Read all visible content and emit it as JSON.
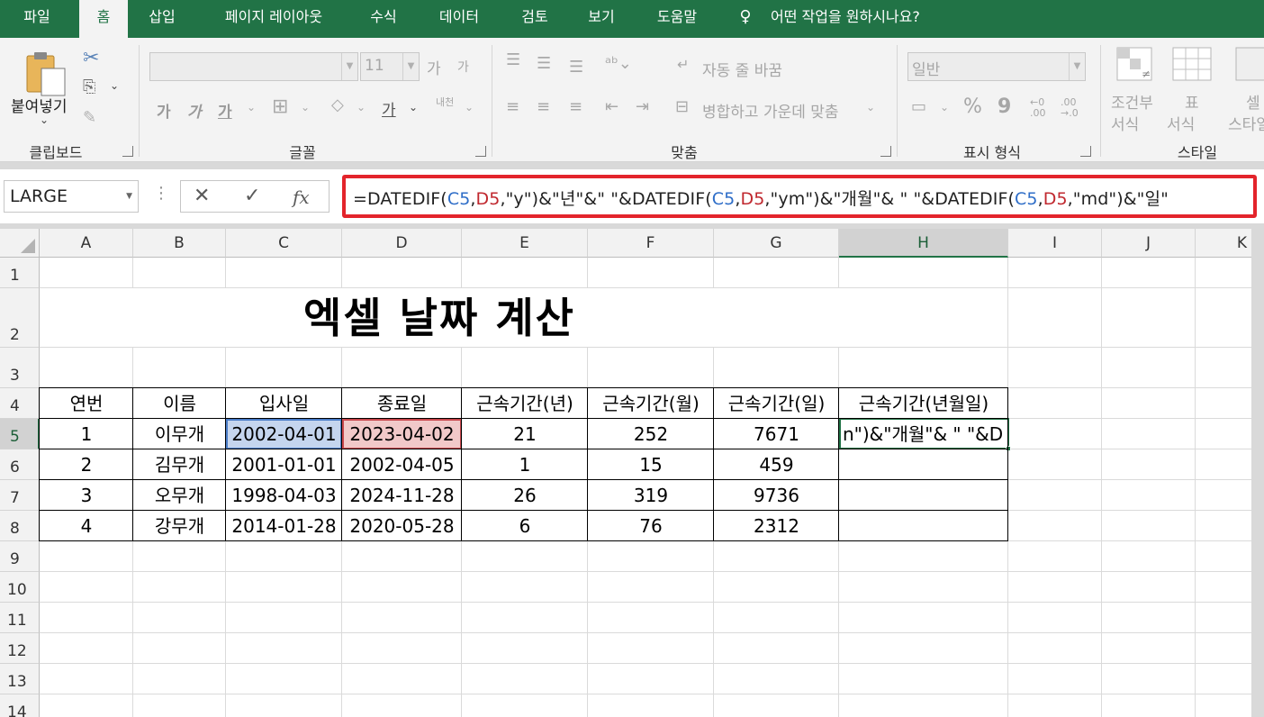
{
  "menu": {
    "tabs": [
      "파일",
      "홈",
      "삽입",
      "페이지 레이아웃",
      "수식",
      "데이터",
      "검토",
      "보기",
      "도움말"
    ],
    "active": "홈",
    "tell_me": "어떤 작업을 원하시나요?"
  },
  "ribbon": {
    "clipboard": {
      "paste": "붙여넣기",
      "label": "클립보드"
    },
    "font": {
      "size": "11",
      "grow": "가",
      "shrink": "가",
      "bold": "가",
      "italic": "가",
      "underline": "가",
      "font_color": "가",
      "phonetic": "내천",
      "label": "글꼴"
    },
    "align": {
      "wrap": "자동 줄 바꿈",
      "merge": "병합하고 가운데 맞춤",
      "label": "맞춤"
    },
    "number": {
      "format": "일반",
      "percent": "%",
      "comma": "9",
      "inc": "←0\n.00",
      "dec": ".00\n→.0",
      "label": "표시 형식"
    },
    "styles": {
      "cond1": "조건부",
      "cond2": "서식",
      "table1": "표",
      "table2": "서식",
      "cell1": "셀",
      "cell2": "스타일",
      "label": "스타일"
    }
  },
  "formula_bar": {
    "name_box": "LARGE",
    "fx": "fx",
    "formula_parts": [
      {
        "t": "=DATEDIF(",
        "k": ""
      },
      {
        "t": "C5",
        "k": "c"
      },
      {
        "t": ",",
        "k": ""
      },
      {
        "t": "D5",
        "k": "d"
      },
      {
        "t": ",\"y\")&\"년\"&\" \"&DATEDIF(",
        "k": ""
      },
      {
        "t": "C5",
        "k": "c"
      },
      {
        "t": ",",
        "k": ""
      },
      {
        "t": "D5",
        "k": "d"
      },
      {
        "t": ",\"ym\")&\"개월\"& \" \"&DATEDIF(",
        "k": ""
      },
      {
        "t": "C5",
        "k": "c"
      },
      {
        "t": ",",
        "k": ""
      },
      {
        "t": "D5",
        "k": "d"
      },
      {
        "t": ",\"md\")&\"일\"",
        "k": ""
      }
    ]
  },
  "sheet": {
    "columns": [
      "A",
      "B",
      "C",
      "D",
      "E",
      "F",
      "G",
      "H",
      "I",
      "J",
      "K"
    ],
    "selected_column": "H",
    "rows": [
      "1",
      "2",
      "3",
      "4",
      "5",
      "6",
      "7",
      "8",
      "9",
      "10",
      "11",
      "12",
      "13",
      "14"
    ],
    "selected_row": "5",
    "title": "엑셀 날짜 계산",
    "headers": [
      "연번",
      "이름",
      "입사일",
      "종료일",
      "근속기간(년)",
      "근속기간(월)",
      "근속기간(일)",
      "근속기간(년월일)"
    ],
    "data": [
      [
        "1",
        "이무개",
        "2002-04-01",
        "2023-04-02",
        "21",
        "252",
        "7671",
        "n\")&\"개월\"& \" \"&D"
      ],
      [
        "2",
        "김무개",
        "2001-01-01",
        "2002-04-05",
        "1",
        "15",
        "459",
        ""
      ],
      [
        "3",
        "오무개",
        "1998-04-03",
        "2024-11-28",
        "26",
        "319",
        "9736",
        ""
      ],
      [
        "4",
        "강무개",
        "2014-01-28",
        "2020-05-28",
        "6",
        "76",
        "2312",
        ""
      ]
    ]
  },
  "colors": {
    "excel_green": "#217346",
    "ref_blue": "#2f6ec8",
    "ref_red": "#c0282f",
    "highlight_box": "#e3242b"
  }
}
